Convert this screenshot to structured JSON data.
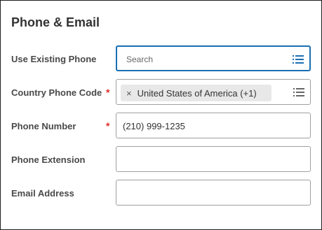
{
  "section_title": "Phone & Email",
  "fields": {
    "use_existing_phone": {
      "label": "Use Existing Phone",
      "placeholder": "Search"
    },
    "country_phone_code": {
      "label": "Country Phone Code",
      "required_mark": "*",
      "selected": "United States of America (+1)",
      "remove_symbol": "×"
    },
    "phone_number": {
      "label": "Phone Number",
      "required_mark": "*",
      "value": "(210) 999-1235"
    },
    "phone_extension": {
      "label": "Phone Extension",
      "value": ""
    },
    "email_address": {
      "label": "Email Address",
      "value": ""
    }
  },
  "colors": {
    "focus_border": "#1a6fb3",
    "required": "#de2d2d",
    "list_icon_active": "#1a6fb3",
    "list_icon_inactive": "#666666"
  }
}
